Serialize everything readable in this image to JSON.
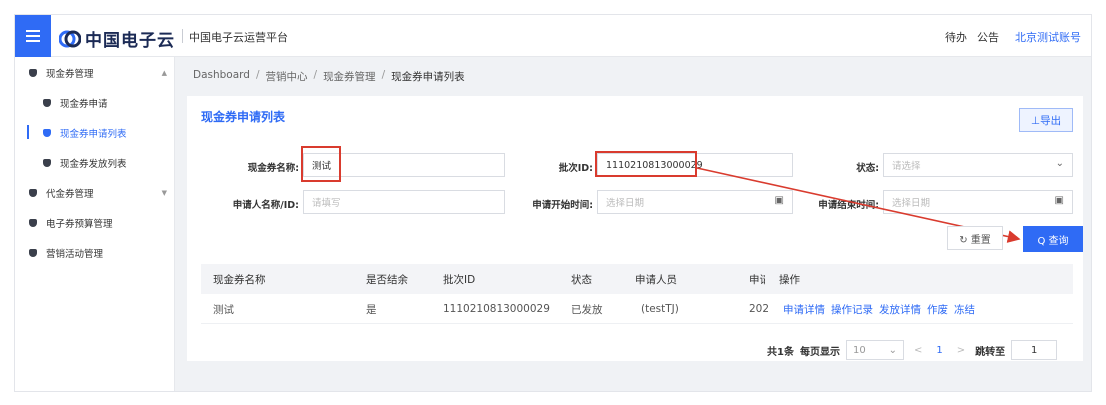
{
  "header": {
    "logo_text": "中国电子云",
    "platform": "中国电子云运营平台",
    "todo": "待办",
    "notice": "公告",
    "account": "北京测试账号"
  },
  "sidebar": {
    "items": [
      {
        "label": "现金券管理"
      },
      {
        "label": "现金券申请"
      },
      {
        "label": "现金券申请列表"
      },
      {
        "label": "现金券发放列表"
      },
      {
        "label": "代金券管理"
      },
      {
        "label": "电子券预算管理"
      },
      {
        "label": "营销活动管理"
      }
    ]
  },
  "breadcrumb": [
    "Dashboard",
    "/",
    "营销中心",
    "/",
    "现金券管理",
    "/",
    "现金券申请列表"
  ],
  "card": {
    "title": "现金券申请列表",
    "export_label": "⊥导出"
  },
  "form": {
    "name_label": "现金券名称:",
    "name_value": "测试",
    "batch_label": "批次ID:",
    "batch_value": "1110210813000029",
    "status_label": "状态:",
    "status_placeholder": "请选择",
    "applicant_label": "申请人名称/ID:",
    "applicant_placeholder": "请填写",
    "start_label": "申请开始时间:",
    "start_placeholder": "选择日期",
    "end_label": "申请结束时间:",
    "end_placeholder": "选择日期",
    "reset_label": "↻ 重置",
    "query_label": "Q 查询"
  },
  "table": {
    "columns": [
      "现金券名称",
      "是否结余",
      "批次ID",
      "状态",
      "申请人员",
      "申请",
      "操作"
    ],
    "rows": [
      {
        "name": "测试",
        "surplus": "是",
        "batch": "1110210813000029",
        "status": "已发放",
        "applicant": "(testTJ)",
        "time": "202"
      }
    ],
    "operations": [
      "申请详情",
      "操作记录",
      "发放详情",
      "作废",
      "冻结"
    ]
  },
  "pagination": {
    "total": "共1条",
    "page_size_label": "每页显示",
    "page_size": "10",
    "prev": "<",
    "current_page": "1",
    "next": ">",
    "jump_label": "跳转至",
    "jump_value": "1"
  },
  "colors": {
    "accent": "#2f6bf5",
    "highlight": "#d93b2e"
  }
}
